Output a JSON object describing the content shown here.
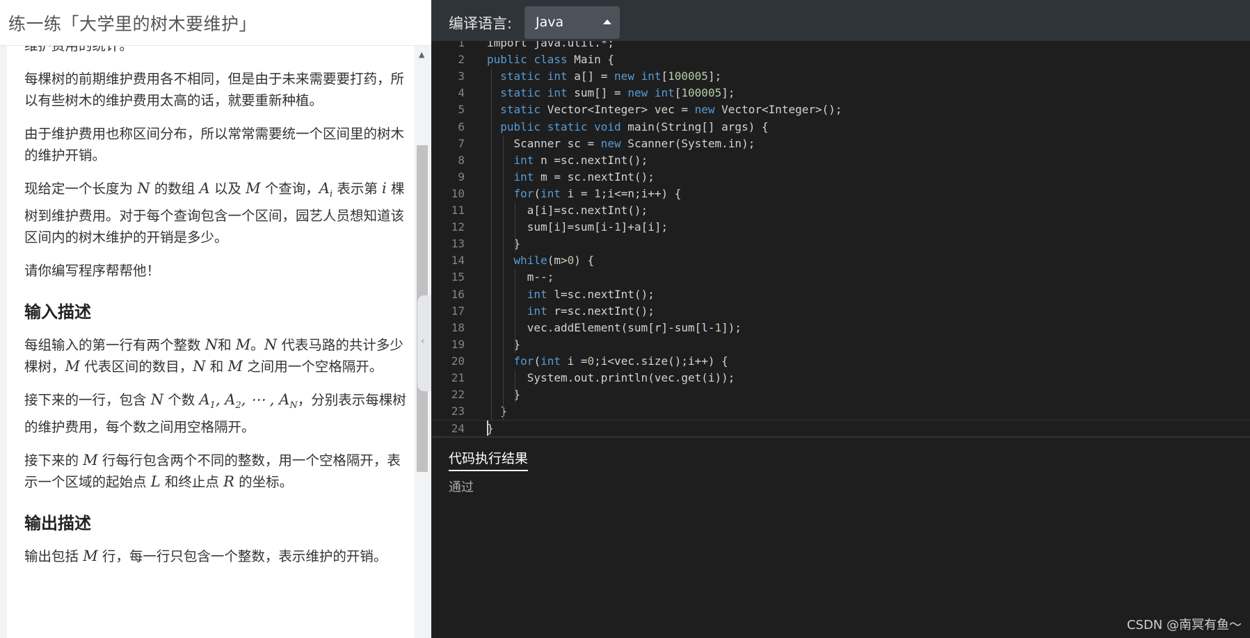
{
  "problem": {
    "title": "练一练「大学里的树木要维护」",
    "paragraphs": {
      "p0": "维护费用的统计。",
      "p1": "每棵树的前期维护费用各不相同，但是由于未来需要要打药，所以有些树木的维护费用太高的话，就要重新种植。",
      "p2": "由于维护费用也称区间分布，所以常常需要统一个区间里的树木的维护开销。",
      "p3_a": "现给定一个长度为 ",
      "p3_N": "N",
      "p3_b": " 的数组 ",
      "p3_A": "A",
      "p3_c": " 以及 ",
      "p3_M": "M",
      "p3_d": " 个查询，",
      "p3_Ai": "A",
      "p3_i": "i",
      "p3_e": " 表示第 ",
      "p3_i2": "i",
      "p3_f": " 棵树到维护费用。对于每个查询包含一个区间，园艺人员想知道该区间内的树木维护的开销是多少。",
      "p4": "请你编写程序帮帮他！"
    },
    "input_heading": "输入描述",
    "input": {
      "a": "每组输入的第一行有两个整数 ",
      "N": "N",
      "b": "和 ",
      "M": "M",
      "c": "。",
      "N2": "N",
      "d": " 代表马路的共计多少棵树，",
      "M2": "M",
      "e": " 代表区间的数目，",
      "N3": "N",
      "f": " 和 ",
      "M3": "M",
      "g": " 之间用一个空格隔开。",
      "h": "接下来的一行，包含 ",
      "N4": "N",
      "i": " 个数 ",
      "seq": "A",
      "s1": "1",
      "comma": ", ",
      "s2": "2",
      "dots": ", ⋯ , ",
      "sN": "N",
      "j": "，分别表示每棵树的维护费用，每个数之间用空格隔开。",
      "k": "接下来的 ",
      "M4": "M",
      "l": " 行每行包含两个不同的整数，用一个空格隔开，表示一个区域的起始点 ",
      "L": "L",
      "m": " 和终止点 ",
      "R": "R",
      "n": " 的坐标。"
    },
    "output_heading": "输出描述",
    "output": {
      "a": "输出包括 ",
      "M": "M",
      "b": " 行，每一行只包含一个整数，表示维护的开销。"
    }
  },
  "toolbar": {
    "language_label": "编译语言:",
    "language_value": "Java"
  },
  "editor": {
    "lines": [
      {
        "n": "1",
        "t": [
          [
            "plain",
            "import java.util.*;"
          ]
        ]
      },
      {
        "n": "2",
        "t": [
          [
            "kw",
            "public"
          ],
          [
            "plain",
            " "
          ],
          [
            "kw",
            "class"
          ],
          [
            "plain",
            " Main {"
          ]
        ]
      },
      {
        "n": "3",
        "t": [
          [
            "plain",
            "  "
          ],
          [
            "kw",
            "static"
          ],
          [
            "plain",
            " "
          ],
          [
            "kw",
            "int"
          ],
          [
            "plain",
            " a[] = "
          ],
          [
            "kw",
            "new"
          ],
          [
            "plain",
            " "
          ],
          [
            "kw",
            "int"
          ],
          [
            "plain",
            "["
          ],
          [
            "num",
            "100005"
          ],
          [
            "plain",
            "];"
          ]
        ]
      },
      {
        "n": "4",
        "t": [
          [
            "plain",
            "  "
          ],
          [
            "kw",
            "static"
          ],
          [
            "plain",
            " "
          ],
          [
            "kw",
            "int"
          ],
          [
            "plain",
            " sum[] = "
          ],
          [
            "kw",
            "new"
          ],
          [
            "plain",
            " "
          ],
          [
            "kw",
            "int"
          ],
          [
            "plain",
            "["
          ],
          [
            "num",
            "100005"
          ],
          [
            "plain",
            "];"
          ]
        ]
      },
      {
        "n": "5",
        "t": [
          [
            "plain",
            "  "
          ],
          [
            "kw",
            "static"
          ],
          [
            "plain",
            " Vector<Integer> vec = "
          ],
          [
            "kw",
            "new"
          ],
          [
            "plain",
            " Vector<Integer>();"
          ]
        ]
      },
      {
        "n": "6",
        "t": [
          [
            "plain",
            "  "
          ],
          [
            "kw",
            "public"
          ],
          [
            "plain",
            " "
          ],
          [
            "kw",
            "static"
          ],
          [
            "plain",
            " "
          ],
          [
            "kw",
            "void"
          ],
          [
            "plain",
            " main(String[] args) {"
          ]
        ]
      },
      {
        "n": "7",
        "t": [
          [
            "plain",
            "    Scanner sc = "
          ],
          [
            "kw",
            "new"
          ],
          [
            "plain",
            " Scanner(System.in);"
          ]
        ]
      },
      {
        "n": "8",
        "t": [
          [
            "plain",
            "    "
          ],
          [
            "kw",
            "int"
          ],
          [
            "plain",
            " n =sc.nextInt();"
          ]
        ]
      },
      {
        "n": "9",
        "t": [
          [
            "plain",
            "    "
          ],
          [
            "kw",
            "int"
          ],
          [
            "plain",
            " m = sc.nextInt();"
          ]
        ]
      },
      {
        "n": "10",
        "t": [
          [
            "plain",
            "    "
          ],
          [
            "kw",
            "for"
          ],
          [
            "plain",
            "("
          ],
          [
            "kw",
            "int"
          ],
          [
            "plain",
            " i = "
          ],
          [
            "num",
            "1"
          ],
          [
            "plain",
            ";i<=n;i++) {"
          ]
        ]
      },
      {
        "n": "11",
        "t": [
          [
            "plain",
            "      a[i]=sc.nextInt();"
          ]
        ]
      },
      {
        "n": "12",
        "t": [
          [
            "plain",
            "      sum[i]=sum[i-"
          ],
          [
            "num",
            "1"
          ],
          [
            "plain",
            "]+a[i];"
          ]
        ]
      },
      {
        "n": "13",
        "t": [
          [
            "plain",
            "    }"
          ]
        ]
      },
      {
        "n": "14",
        "t": [
          [
            "plain",
            "    "
          ],
          [
            "kw",
            "while"
          ],
          [
            "plain",
            "(m>"
          ],
          [
            "num",
            "0"
          ],
          [
            "plain",
            ") {"
          ]
        ]
      },
      {
        "n": "15",
        "t": [
          [
            "plain",
            "      m--;"
          ]
        ]
      },
      {
        "n": "16",
        "t": [
          [
            "plain",
            "      "
          ],
          [
            "kw",
            "int"
          ],
          [
            "plain",
            " l=sc.nextInt();"
          ]
        ]
      },
      {
        "n": "17",
        "t": [
          [
            "plain",
            "      "
          ],
          [
            "kw",
            "int"
          ],
          [
            "plain",
            " r=sc.nextInt();"
          ]
        ]
      },
      {
        "n": "18",
        "t": [
          [
            "plain",
            "      vec.addElement(sum[r]-sum[l-"
          ],
          [
            "num",
            "1"
          ],
          [
            "plain",
            "]);"
          ]
        ]
      },
      {
        "n": "19",
        "t": [
          [
            "plain",
            "    }"
          ]
        ]
      },
      {
        "n": "20",
        "t": [
          [
            "plain",
            "    "
          ],
          [
            "kw",
            "for"
          ],
          [
            "plain",
            "("
          ],
          [
            "kw",
            "int"
          ],
          [
            "plain",
            " i ="
          ],
          [
            "num",
            "0"
          ],
          [
            "plain",
            ";i<vec.size();i++) {"
          ]
        ]
      },
      {
        "n": "21",
        "t": [
          [
            "plain",
            "      System.out.println(vec.get(i));"
          ]
        ]
      },
      {
        "n": "22",
        "t": [
          [
            "plain",
            "    }"
          ]
        ]
      },
      {
        "n": "23",
        "t": [
          [
            "plain",
            "  }"
          ]
        ]
      },
      {
        "n": "24",
        "t": [
          [
            "plain",
            "}"
          ]
        ]
      }
    ]
  },
  "result": {
    "tab_label": "代码执行结果",
    "text": "通过"
  },
  "watermark": "CSDN @南冥有鱼～"
}
